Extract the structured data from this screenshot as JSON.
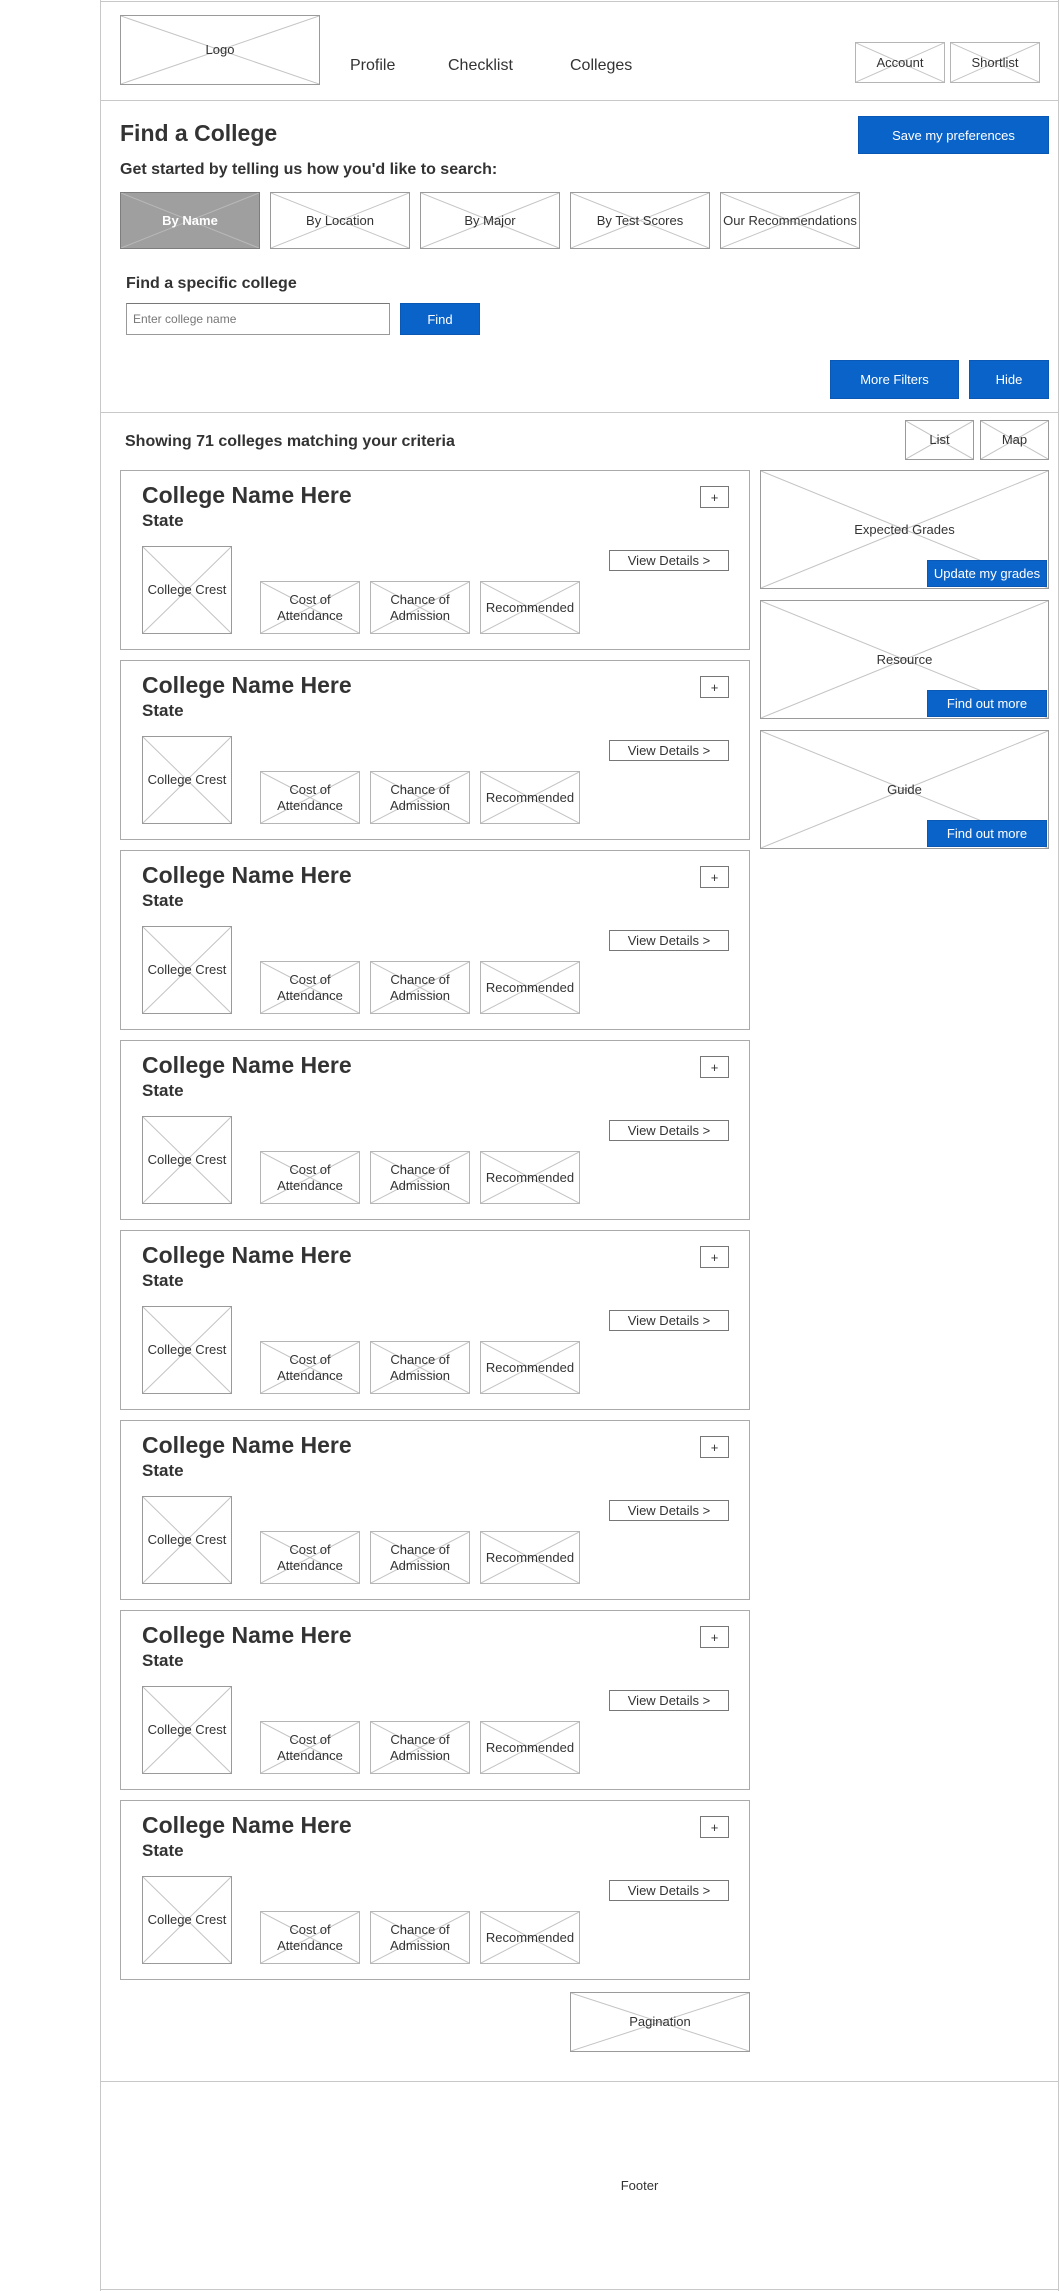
{
  "header": {
    "logo": "Logo",
    "nav": [
      "Profile",
      "Checklist",
      "Colleges"
    ],
    "account": "Account",
    "shortlist": "Shortlist"
  },
  "search": {
    "title": "Find a College",
    "save_prefs": "Save my preferences",
    "subtitle": "Get started by telling us how you'd like to search:",
    "tabs": [
      "By Name",
      "By Location",
      "By Major",
      "By Test Scores",
      "Our Recommendations"
    ],
    "specific_title": "Find a specific college",
    "input_placeholder": "Enter college name",
    "find": "Find",
    "more_filters": "More Filters",
    "hide": "Hide"
  },
  "results": {
    "summary": "Showing 71 colleges matching your criteria",
    "view_list": "List",
    "view_map": "Map",
    "cards": [
      {
        "name": "College Name Here",
        "state": "State",
        "crest": "College Crest",
        "cost": "Cost of Attendance",
        "chance": "Chance of Admission",
        "recommended": "Recommended",
        "details": "View Details >",
        "add": "+"
      },
      {
        "name": "College Name Here",
        "state": "State",
        "crest": "College Crest",
        "cost": "Cost of Attendance",
        "chance": "Chance of Admission",
        "recommended": "Recommended",
        "details": "View Details >",
        "add": "+"
      },
      {
        "name": "College Name Here",
        "state": "State",
        "crest": "College Crest",
        "cost": "Cost of Attendance",
        "chance": "Chance of Admission",
        "recommended": "Recommended",
        "details": "View Details >",
        "add": "+"
      },
      {
        "name": "College Name Here",
        "state": "State",
        "crest": "College Crest",
        "cost": "Cost of Attendance",
        "chance": "Chance of Admission",
        "recommended": "Recommended",
        "details": "View Details >",
        "add": "+"
      },
      {
        "name": "College Name Here",
        "state": "State",
        "crest": "College Crest",
        "cost": "Cost of Attendance",
        "chance": "Chance of Admission",
        "recommended": "Recommended",
        "details": "View Details >",
        "add": "+"
      },
      {
        "name": "College Name Here",
        "state": "State",
        "crest": "College Crest",
        "cost": "Cost of Attendance",
        "chance": "Chance of Admission",
        "recommended": "Recommended",
        "details": "View Details >",
        "add": "+"
      },
      {
        "name": "College Name Here",
        "state": "State",
        "crest": "College Crest",
        "cost": "Cost of Attendance",
        "chance": "Chance of Admission",
        "recommended": "Recommended",
        "details": "View Details >",
        "add": "+"
      },
      {
        "name": "College Name Here",
        "state": "State",
        "crest": "College Crest",
        "cost": "Cost of Attendance",
        "chance": "Chance of Admission",
        "recommended": "Recommended",
        "details": "View Details >",
        "add": "+"
      }
    ],
    "pagination": "Pagination"
  },
  "sidebar": [
    {
      "label": "Expected Grades",
      "button": "Update my grades"
    },
    {
      "label": "Resource",
      "button": "Find out more"
    },
    {
      "label": "Guide",
      "button": "Find out more"
    }
  ],
  "footer": "Footer",
  "colors": {
    "accent": "#0a63c9",
    "active_tab": "#9f9f9f",
    "border": "#aaaaaa"
  }
}
